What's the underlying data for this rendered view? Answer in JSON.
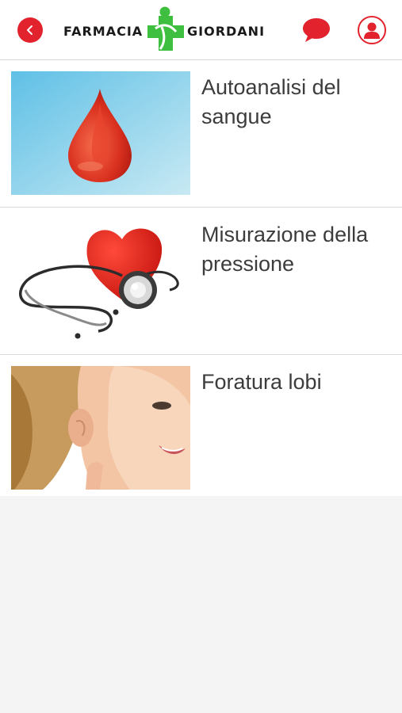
{
  "header": {
    "logo_left": "FARMACIA",
    "logo_right": "GIORDANI",
    "back_icon": "chevron-left-icon",
    "chat_icon": "chat-bubble-icon",
    "user_icon": "user-icon",
    "accent_color": "#e2232e",
    "logo_green": "#3fbf3f"
  },
  "services": [
    {
      "title": "Autoanalisi del sangue",
      "image": "blood-drop-image"
    },
    {
      "title": "Misurazione della pressione",
      "image": "heart-stethoscope-image"
    },
    {
      "title": "Foratura lobi",
      "image": "child-ear-image"
    }
  ]
}
